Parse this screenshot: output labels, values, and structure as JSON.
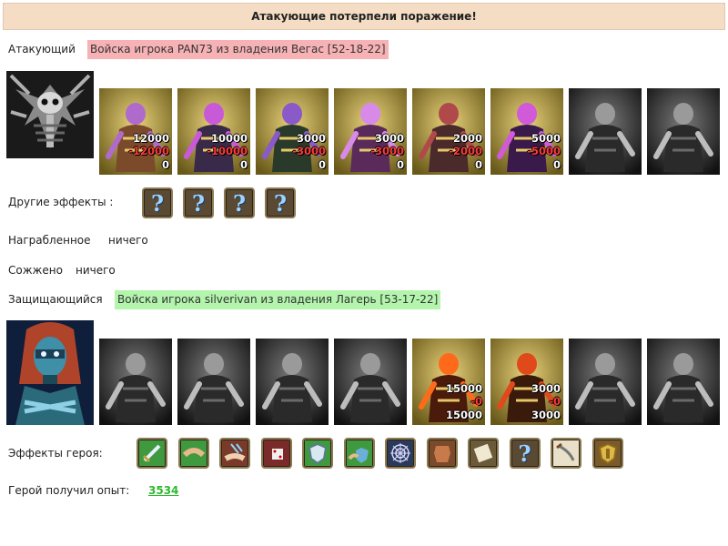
{
  "banner": "Атакующие потерпели поражение!",
  "attacker": {
    "label": "Атакующий",
    "army": "Войска игрока PAN73 из владения Вегас [52-18-22]",
    "hero_icon": "skull-demon-portrait-icon",
    "units": [
      {
        "icon": "ogre-brute-icon",
        "tone": "color",
        "count": "12000",
        "lost": "-12000",
        "left": "0"
      },
      {
        "icon": "dark-swordsman-icon",
        "tone": "color",
        "count": "10000",
        "lost": "-10000",
        "left": "0"
      },
      {
        "icon": "lizard-rider-icon",
        "tone": "color",
        "count": "3000",
        "lost": "-3000",
        "left": "0"
      },
      {
        "icon": "harpy-icon",
        "tone": "color",
        "count": "3000",
        "lost": "-3000",
        "left": "0"
      },
      {
        "icon": "archer-icon",
        "tone": "color",
        "count": "2000",
        "lost": "-2000",
        "left": "0"
      },
      {
        "icon": "sorceress-icon",
        "tone": "color",
        "count": "5000",
        "lost": "-5000",
        "left": "0"
      },
      {
        "icon": "hooded-assassin-icon",
        "tone": "gray"
      },
      {
        "icon": "armored-knight-icon",
        "tone": "gray"
      }
    ],
    "effects_label": "Другие эффекты :",
    "effects": [
      "question-mark-icon",
      "question-mark-icon",
      "question-mark-icon",
      "question-mark-icon"
    ]
  },
  "loot": {
    "label": "Награбленное",
    "value": "ничего"
  },
  "burned": {
    "label": "Сожжено",
    "value": "ничего"
  },
  "defender": {
    "label": "Защищающийся",
    "army": "Войска игрока silverivan из владения Лагерь [53-17-22]",
    "hero_icon": "masked-elf-portrait-icon",
    "units": [
      {
        "icon": "catapult-icon",
        "tone": "gray"
      },
      {
        "icon": "skeleton-warrior-icon",
        "tone": "gray"
      },
      {
        "icon": "ghoul-icon",
        "tone": "gray"
      },
      {
        "icon": "gargoyle-icon",
        "tone": "gray"
      },
      {
        "icon": "fire-elemental-icon",
        "tone": "color",
        "count": "15000",
        "lost": "-0",
        "left": "15000"
      },
      {
        "icon": "flame-warrior-icon",
        "tone": "color",
        "count": "3000",
        "lost": "-0",
        "left": "3000"
      },
      {
        "icon": "horned-knight-icon",
        "tone": "gray"
      },
      {
        "icon": "wraith-icon",
        "tone": "gray"
      }
    ],
    "effects_label": "Эффекты героя:",
    "effects": [
      "sword-icon",
      "handshake-icon",
      "magic-hand-icon",
      "dice-icon",
      "shield-icon",
      "shield-hand-icon",
      "web-icon",
      "armor-icon",
      "scroll-icon",
      "question-mark-icon",
      "saber-icon",
      "golden-shield-icon"
    ]
  },
  "xp": {
    "label": "Герой получил опыт:",
    "value": "3534"
  },
  "colors": {
    "attacker_tag": "#f7b2b5",
    "defender_tag": "#b3f5ad",
    "banner": "#f5dcc4",
    "xp": "#2fb82f"
  }
}
